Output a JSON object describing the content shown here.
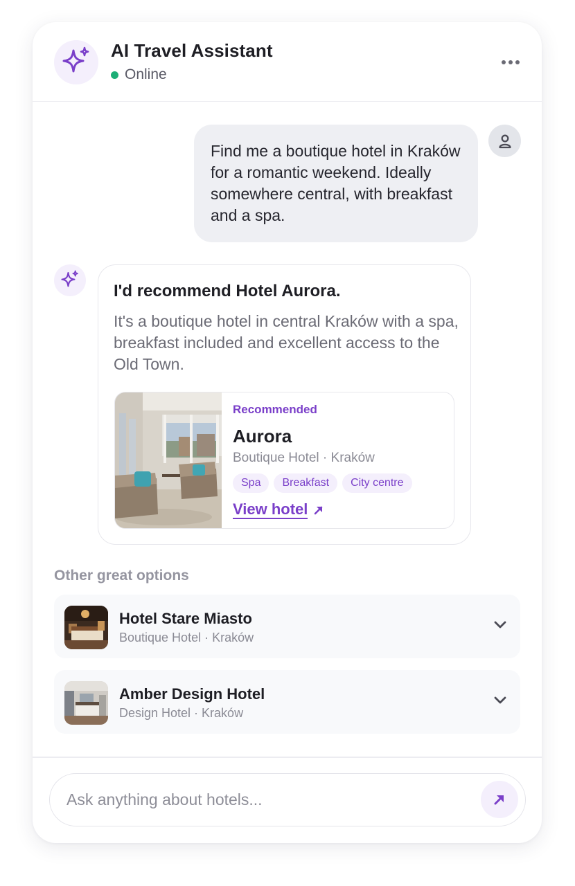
{
  "header": {
    "title": "AI Travel Assistant",
    "status": "Online",
    "icons": {
      "avatar": "sparkles-icon",
      "menu": "more-horizontal-icon"
    }
  },
  "user_message": {
    "text": "Find me a boutique hotel in Kraków for a romantic weekend. Ideally somewhere central, with breakfast and a spa.",
    "icon": "user-icon"
  },
  "ai_message": {
    "heading": "I'd recommend Hotel Aurora.",
    "body": "It's a boutique hotel in central Kraków with a spa, breakfast included and excellent access to the Old Town.",
    "icon": "sparkles-icon",
    "hotel_card": {
      "label": "Recommended",
      "name": "Aurora",
      "subtitle": "Boutique Hotel · Kraków",
      "tags": [
        "Spa",
        "Breakfast",
        "City centre"
      ],
      "link_label": "View hotel",
      "link_icon": "arrow-up-right-icon"
    }
  },
  "other_options": {
    "label": "Other great options",
    "items": [
      {
        "name": "Hotel Stare Miasto",
        "subtitle": "Boutique Hotel · Kraków",
        "icon": "chevron-down-icon"
      },
      {
        "name": "Amber Design Hotel",
        "subtitle": "Design Hotel · Kraków",
        "icon": "chevron-down-icon"
      }
    ]
  },
  "composer": {
    "placeholder": "Ask anything about hotels...",
    "send_icon": "arrow-up-right-icon"
  },
  "colors": {
    "accent": "#7a3fc9",
    "accent_soft": "#f4effc",
    "online": "#1cae76",
    "user_bubble": "#eeeff3"
  }
}
